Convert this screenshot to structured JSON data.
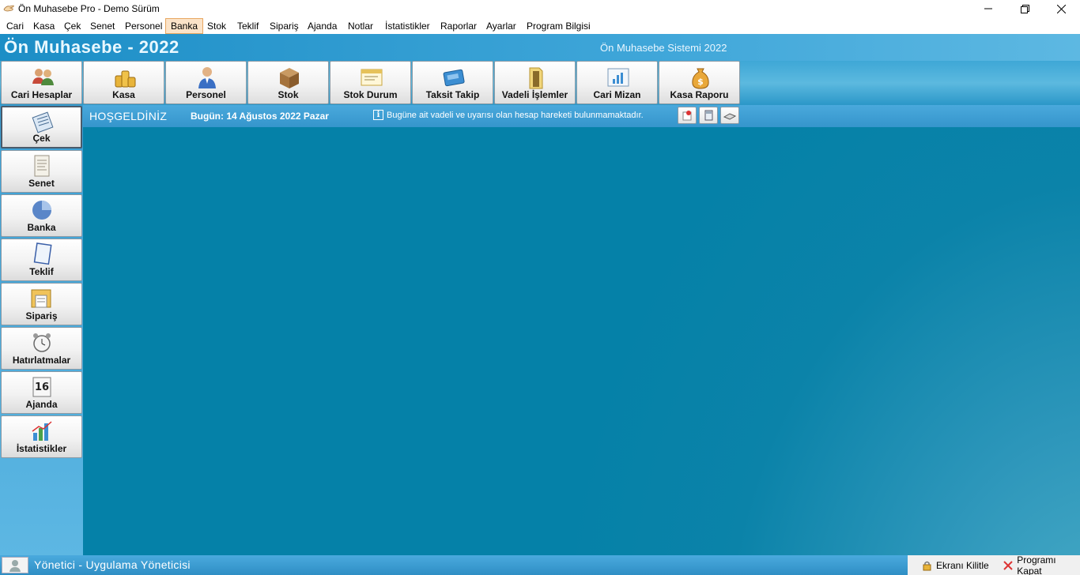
{
  "window": {
    "title": "Ön Muhasebe Pro - Demo Sürüm",
    "controls": [
      "minimize",
      "restore",
      "close"
    ]
  },
  "menu": {
    "items": [
      "Cari",
      "Kasa",
      "Çek",
      "Senet",
      "Personel",
      "Banka",
      "Stok",
      "Teklif",
      "Sipariş",
      "Ajanda",
      "Notlar",
      "İstatistikler",
      "Raporlar",
      "Ayarlar",
      "Program Bilgisi"
    ],
    "active": "Banka"
  },
  "header": {
    "app_title": "Ön Muhasebe - 2022",
    "subtitle": "Ön Muhasebe Sistemi 2022"
  },
  "toolbar": {
    "buttons": [
      {
        "label": "Cari Hesaplar",
        "icon": "users-icon"
      },
      {
        "label": "Kasa",
        "icon": "coins-icon"
      },
      {
        "label": "Personel",
        "icon": "person-icon"
      },
      {
        "label": "Stok",
        "icon": "box-icon"
      },
      {
        "label": "Stok Durum",
        "icon": "window-icon"
      },
      {
        "label": "Taksit Takip",
        "icon": "card-icon"
      },
      {
        "label": "Vadeli İşlemler",
        "icon": "folder-icon"
      },
      {
        "label": "Cari Mizan",
        "icon": "chart-window-icon"
      },
      {
        "label": "Kasa Raporu",
        "icon": "money-bag-icon"
      }
    ]
  },
  "sidebar": {
    "buttons": [
      {
        "label": "Çek",
        "icon": "check-document-icon"
      },
      {
        "label": "Senet",
        "icon": "note-document-icon"
      },
      {
        "label": "Banka",
        "icon": "pie-icon"
      },
      {
        "label": "Teklif",
        "icon": "page-icon"
      },
      {
        "label": "Sipariş",
        "icon": "order-icon"
      },
      {
        "label": "Hatırlatmalar",
        "icon": "alarm-clock-icon"
      },
      {
        "label": "Ajanda",
        "icon": "calendar-icon"
      },
      {
        "label": "İstatistikler",
        "icon": "bar-chart-icon"
      }
    ],
    "active": "Çek",
    "calendar_day": "16"
  },
  "infostrip": {
    "welcome": "HOŞGELDİNİZ",
    "date": "Bugün: 14 Ağustos 2022 Pazar",
    "message": "Bugüne ait vadeli ve uyarısı olan hesap hareketi bulunmamaktadır."
  },
  "status": {
    "user": "Yönetici - Uygulama Yöneticisi",
    "lock_label": "Ekranı Kilitle",
    "exit_label": "Programı Kapat"
  },
  "colors": {
    "header_blue": "#1c8ec6",
    "content_teal": "#0581a8",
    "menu_active_bg": "#fbe3c8",
    "menu_active_border": "#e8a761"
  }
}
